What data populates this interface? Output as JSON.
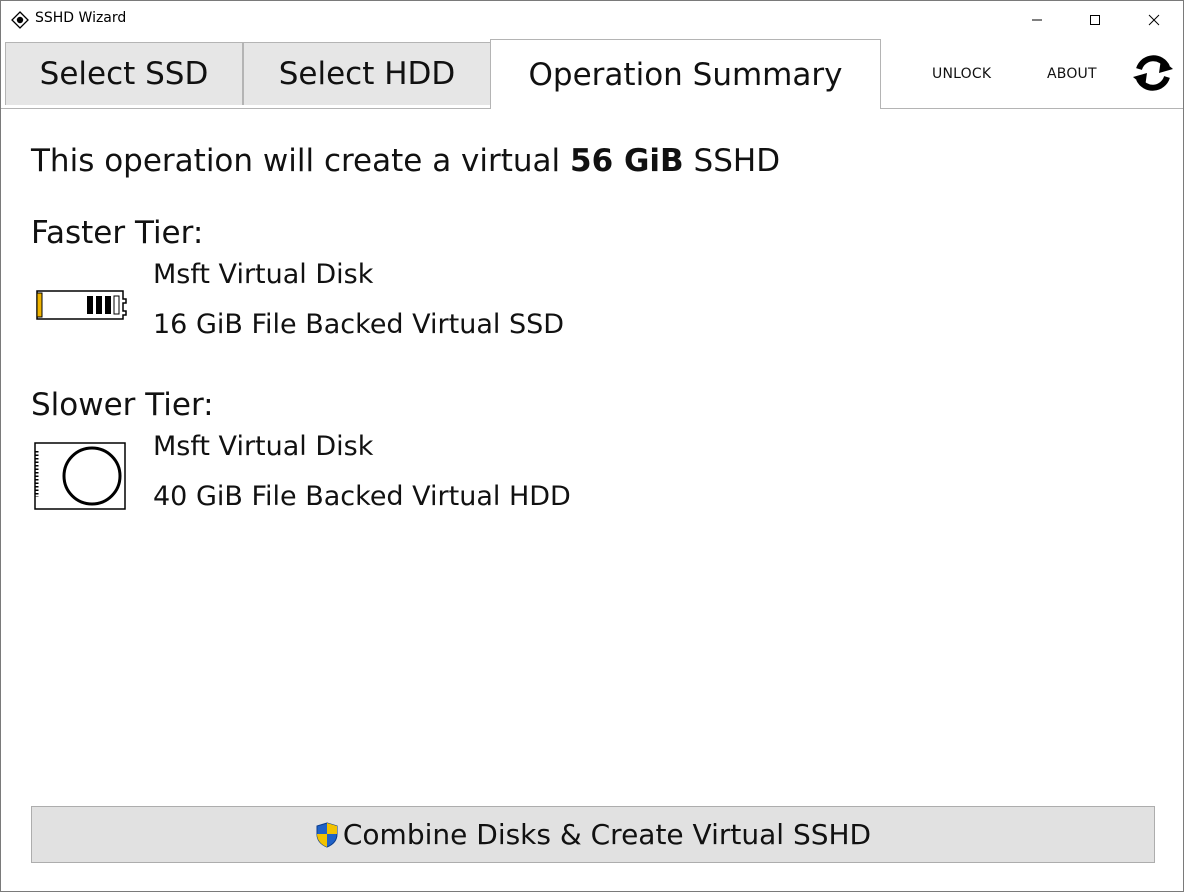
{
  "window": {
    "title": "SSHD Wizard"
  },
  "tabs": [
    {
      "label": "Select SSD",
      "active": false
    },
    {
      "label": "Select HDD",
      "active": false
    },
    {
      "label": "Operation Summary",
      "active": true
    }
  ],
  "header_links": {
    "unlock": "UNLOCK",
    "about": "ABOUT"
  },
  "summary": {
    "intro": "This operation will create a virtual",
    "size": "56 GiB",
    "suffix": "SSHD"
  },
  "faster_tier": {
    "label": "Faster Tier:",
    "disk_name": "Msft Virtual Disk",
    "disk_desc": "16 GiB File Backed Virtual SSD",
    "icon": "ssd-icon"
  },
  "slower_tier": {
    "label": "Slower Tier:",
    "disk_name": "Msft Virtual Disk",
    "disk_desc": "40 GiB File Backed Virtual HDD",
    "icon": "hdd-icon"
  },
  "action": {
    "label": "Combine Disks & Create Virtual SSHD",
    "icon": "uac-shield-icon"
  },
  "colors": {
    "tab_inactive": "#e6e6e6",
    "button_bg": "#e1e1e1",
    "ssd_accent": "#f0b400",
    "shield_blue": "#1f62c8",
    "shield_yellow": "#f2c200"
  }
}
